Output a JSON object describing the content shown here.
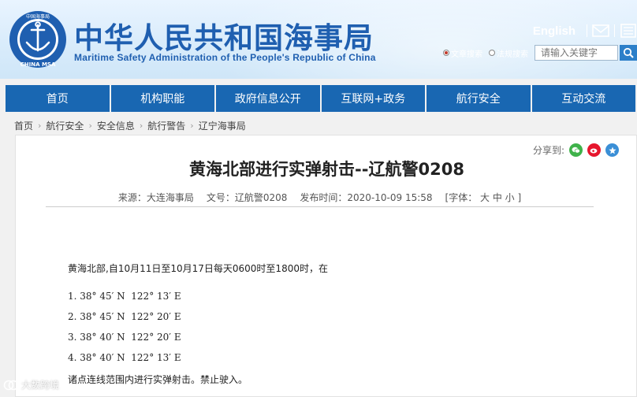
{
  "header": {
    "title_cn": "中华人民共和国海事局",
    "title_en": "Maritime Safety Administration of the People's Republic of China",
    "logo_text_top": "中国海事局",
    "logo_text_bottom": "CHINA MSA",
    "lang_link": "English",
    "search": {
      "options": [
        "文章搜索",
        "法规搜索"
      ],
      "selected": "文章搜索",
      "placeholder": "请输入关键字"
    }
  },
  "nav": [
    "首页",
    "机构职能",
    "政府信息公开",
    "互联网+政务",
    "航行安全",
    "互动交流"
  ],
  "breadcrumb": [
    "首页",
    "航行安全",
    "安全信息",
    "航行警告",
    "辽宁海事局"
  ],
  "article": {
    "share_label": "分享到:",
    "title": "黄海北部进行实弹射击--辽航警0208",
    "meta": {
      "source": "来源：大连海事局",
      "doc_no": "文号：辽航警0208",
      "published": "发布时间：2020-10-09 15:58",
      "font_size": "[字体： 大  中  小 ]"
    },
    "intro": "黄海北部,自10月11日至10月17日每天0600时至1800时，在",
    "coordinates": [
      "1. 38° 45′ N  122° 13′ E",
      "2. 38° 45′ N  122° 20′ E",
      "3. 38° 40′ N  122° 20′ E",
      "4. 38° 40′ N  122° 13′ E"
    ],
    "tail": "诸点连线范围内进行实弹射击。禁止驶入。"
  },
  "watermark": "大数跨境",
  "colors": {
    "nav_bg": "#1967b2",
    "title_blue": "#1f5fb0",
    "wechat": "#3fb24a",
    "weibo": "#e6162d"
  }
}
